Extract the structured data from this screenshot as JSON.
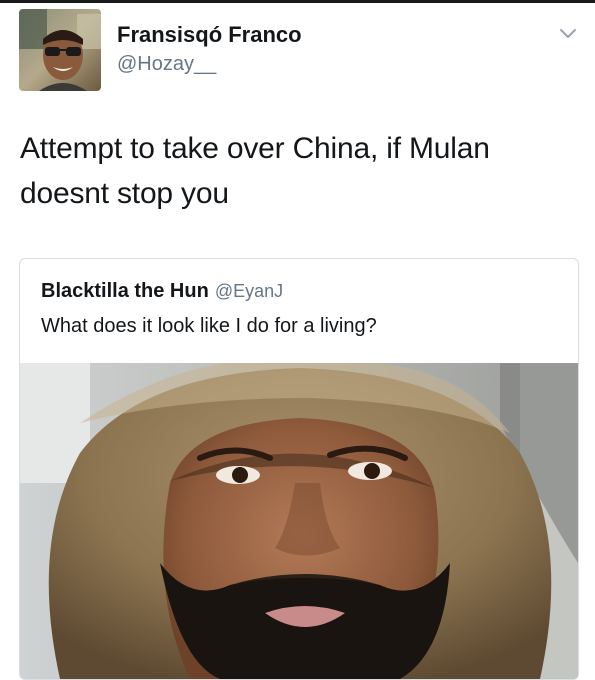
{
  "tweet": {
    "display_name": "Fransisqó Franco",
    "handle": "@Hozay__",
    "text": "Attempt to take over China, if Mulan doesnt stop you",
    "caret_icon": "chevron-down-icon"
  },
  "quoted_tweet": {
    "display_name": "Blacktilla the Hun",
    "handle": "@EyanJ",
    "text": "What does it look like I do for a living?"
  },
  "colors": {
    "text_primary": "#14171a",
    "text_secondary": "#657786",
    "card_border": "#d8dee3"
  }
}
